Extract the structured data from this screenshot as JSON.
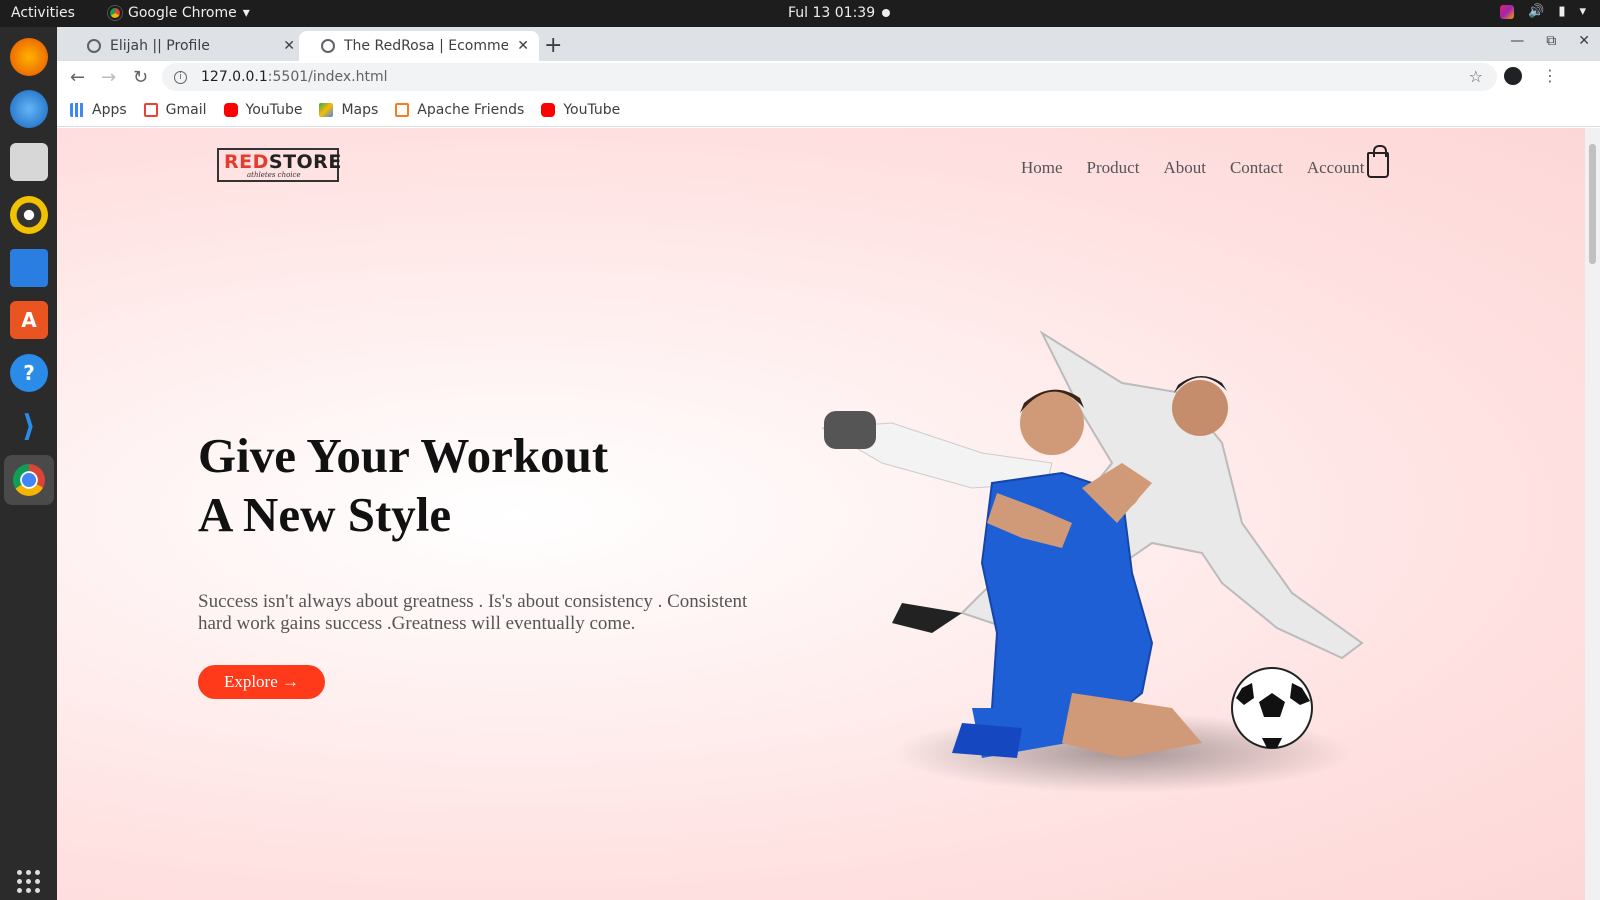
{
  "topbar": {
    "activities": "Activities",
    "app_name": "Google Chrome",
    "clock": "Ful 13  01:39"
  },
  "browser": {
    "tabs": [
      {
        "title": "Elijah || Profile"
      },
      {
        "title": "The RedRosa | Ecommerce"
      }
    ],
    "url_host": "127.0.0.1",
    "url_path": ":5501/index.html",
    "bookmarks": [
      {
        "label": "Apps",
        "icon": "apps-grid-icon",
        "color": "#4285f4"
      },
      {
        "label": "Gmail",
        "icon": "gmail-icon",
        "color": "#ea4335"
      },
      {
        "label": "YouTube",
        "icon": "youtube-icon",
        "color": "#ff0000"
      },
      {
        "label": "Maps",
        "icon": "maps-icon",
        "color": "#34a853"
      },
      {
        "label": "Apache Friends",
        "icon": "xampp-icon",
        "color": "#fb7a24"
      },
      {
        "label": "YouTube",
        "icon": "youtube-icon",
        "color": "#ff0000"
      }
    ]
  },
  "page": {
    "logo_prefix": "RED",
    "logo_suffix": "STORE",
    "logo_tagline": "athletes choice",
    "nav": [
      "Home",
      "Product",
      "About",
      "Contact",
      "Account"
    ],
    "hero_title_line1": "Give Your Workout",
    "hero_title_line2": "A New Style",
    "hero_text": "Success isn't always about greatness . Is's about consistency . Consistent hard work gains success .Greatness will eventually come.",
    "explore_label": "Explore →",
    "accent_color": "#ff3a1a"
  }
}
